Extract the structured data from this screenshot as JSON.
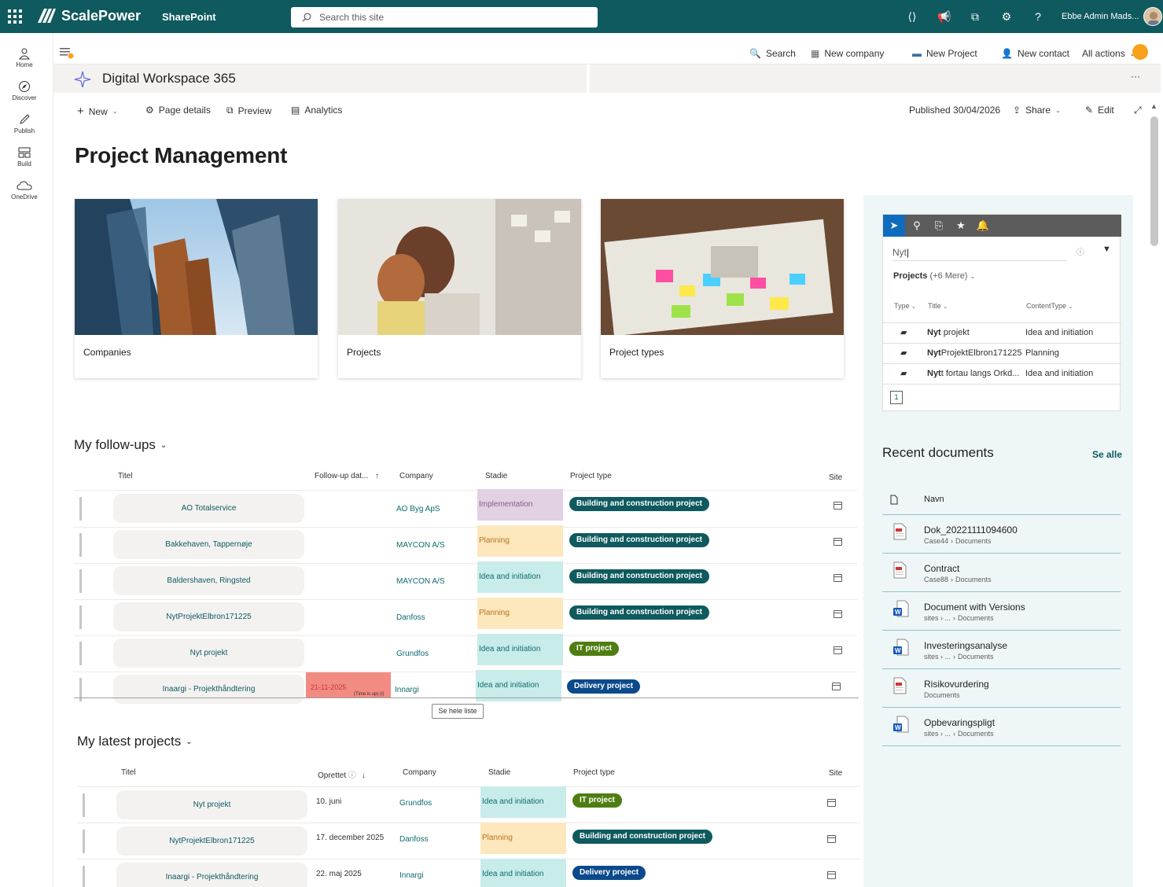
{
  "suite": {
    "brand": "ScalePower",
    "app": "SharePoint",
    "search_placeholder": "Search this site",
    "user": "Ebbe Admin Mads..."
  },
  "rail": [
    {
      "label": "Home",
      "icon": "home-icon"
    },
    {
      "label": "Discover",
      "icon": "discover-icon"
    },
    {
      "label": "Publish",
      "icon": "publish-icon"
    },
    {
      "label": "Build",
      "icon": "build-icon"
    },
    {
      "label": "OneDrive",
      "icon": "onedrive-icon"
    }
  ],
  "hub_actions": {
    "search": "Search",
    "new_company": "New company",
    "new_project": "New Project",
    "new_contact": "New contact",
    "all_actions": "All actions"
  },
  "site": {
    "title": "Digital Workspace 365",
    "more": "···"
  },
  "commands": {
    "new": "New",
    "page_details": "Page details",
    "preview": "Preview",
    "analytics": "Analytics",
    "published": "Published 30/04/2026",
    "share": "Share",
    "edit": "Edit"
  },
  "page_title": "Project Management",
  "cards": [
    "Companies",
    "Projects",
    "Project types"
  ],
  "followups": {
    "title": "My follow-ups",
    "headers": {
      "titel": "Titel",
      "followup": "Follow-up dat...",
      "company": "Company",
      "stadie": "Stadie",
      "ptype": "Project type",
      "site": "Site"
    },
    "rows": [
      {
        "title": "AO Totalservice",
        "date": "",
        "company": "AO Byg ApS",
        "stage": "Implementation",
        "ptype": "Building and construction project"
      },
      {
        "title": "Bakkehaven, Tappernøje",
        "date": "",
        "company": "MAYCON A/S",
        "stage": "Planning",
        "ptype": "Building and construction project"
      },
      {
        "title": "Baldershaven, Ringsted",
        "date": "",
        "company": "MAYCON A/S",
        "stage": "Idea and initiation",
        "ptype": "Building and construction project"
      },
      {
        "title": "NytProjektElbron171225",
        "date": "",
        "company": "Danfoss",
        "stage": "Planning",
        "ptype": "Building and construction project"
      },
      {
        "title": "Nyt projekt",
        "date": "",
        "company": "Grundfos",
        "stage": "Idea and initiation",
        "ptype": "IT project"
      },
      {
        "title": "Inaargi - Projekthåndtering",
        "date": "21-11-2025",
        "company": "Innargi",
        "stage": "Idea and initiation",
        "ptype": "Delivery project"
      }
    ],
    "see_all": "Se hele liste",
    "overdue_note": "(Time is up) (i)"
  },
  "latest": {
    "title": "My latest projects",
    "headers": {
      "titel": "Titel",
      "oprettet": "Oprettet",
      "company": "Company",
      "stadie": "Stadie",
      "ptype": "Project type",
      "site": "Site"
    },
    "rows": [
      {
        "title": "Nyt projekt",
        "date": "10. juni",
        "company": "Grundfos",
        "stage": "Idea and initiation",
        "ptype": "IT project"
      },
      {
        "title": "NytProjektElbron171225",
        "date": "17. december 2025",
        "company": "Danfoss",
        "stage": "Planning",
        "ptype": "Building and construction project"
      },
      {
        "title": "Inaargi - Projekthåndtering",
        "date": "22. maj 2025",
        "company": "Innargi",
        "stage": "Idea and initiation",
        "ptype": "Delivery project"
      }
    ]
  },
  "search_wp": {
    "query": "Nyt",
    "scope": "Projects",
    "scope_more": "(+6 Mere)",
    "headers": {
      "type": "Type",
      "title": "Title",
      "ctype": "ContentType"
    },
    "results": [
      {
        "bold": "Nyt",
        "rest": " projekt",
        "ctype": "Idea and initiation"
      },
      {
        "bold": "Nyt",
        "rest": "ProjektElbron171225",
        "ctype": "Planning"
      },
      {
        "bold": "Nyt",
        "rest": "t fortau langs Orkd...",
        "ctype": "Idea and initiation"
      }
    ],
    "page": "1"
  },
  "recent": {
    "title": "Recent documents",
    "see_all": "Se alle",
    "header": "Navn",
    "docs": [
      {
        "name": "Dok_20221111094600",
        "path1": "Case44",
        "path2": "Documents",
        "kind": "pdf"
      },
      {
        "name": "Contract",
        "path1": "Case88",
        "path2": "Documents",
        "kind": "pdf"
      },
      {
        "name": "Document with Versions",
        "path1": "sites › ...",
        "path2": "Documents",
        "kind": "word"
      },
      {
        "name": "Investeringsanalyse",
        "path1": "sites › ...",
        "path2": "Documents",
        "kind": "word"
      },
      {
        "name": "Risikovurdering",
        "path1": "",
        "path2": "Documents",
        "kind": "pdf"
      },
      {
        "name": "Opbevaringspligt",
        "path1": "sites › ...",
        "path2": "Documents",
        "kind": "word"
      }
    ]
  },
  "colors": {
    "suite": "#0f5a5e",
    "stage_implementation": "#e2d0e3",
    "stage_planning": "#fde7bd",
    "stage_idea": "#c8ecea",
    "ptype_building": "#0f5a5e",
    "ptype_it": "#4f7d12",
    "ptype_delivery": "#0b4a8b",
    "overdue": "#f28b82"
  }
}
